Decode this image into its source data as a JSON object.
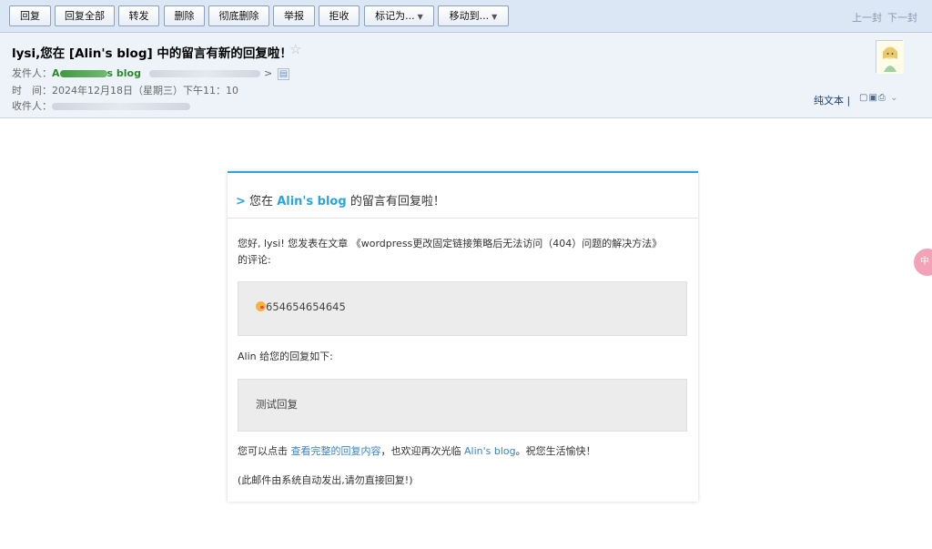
{
  "toolbar": {
    "buttons": [
      "回复",
      "回复全部",
      "转发",
      "删除",
      "彻底删除",
      "举报",
      "拒收"
    ],
    "mark_as": "标记为...",
    "move_to": "移动到...",
    "prev": "上一封",
    "next": "下一封"
  },
  "header": {
    "subject": "lysi,您在 [Alin's blog] 中的留言有新的回复啦！",
    "sender_label": "发件人：",
    "sender_name_start": "A",
    "sender_name_end": "s blog",
    "address_end": ">",
    "time_label": "时　间：",
    "time_value": "2024年12月18日（星期三）下午11：10",
    "recipient_label": "收件人：",
    "plaintext": "纯文本",
    "divider": "|"
  },
  "email": {
    "title_arrow": ">",
    "title_pre": "您在",
    "title_blog": "Alin's blog",
    "title_post": "的留言有回复啦！",
    "greeting_line1": "您好, lysi! 您发表在文章 《wordpress更改固定链接策略后无法访问（404）问题的解决方法》",
    "greeting_line2": "的评论:",
    "comment_text": "654654654645",
    "reply_intro": "Alin 给您的回复如下:",
    "reply_text": "测试回复",
    "footer_pre": "您可以点击",
    "footer_link": "查看完整的回复内容",
    "footer_mid": "，也欢迎再次光临",
    "footer_blog": "Alin's blog",
    "footer_post": "。祝您生活愉快！",
    "auto_note": "(此邮件由系统自动发出,请勿直接回复!)"
  },
  "side_badge": "中",
  "colors": {
    "accent": "#2aa4e0",
    "toolbar_bg": "#dce7f6",
    "header_bg": "#eef3fa",
    "sender_green": "#2a8a2a",
    "link": "#3a83c6"
  }
}
